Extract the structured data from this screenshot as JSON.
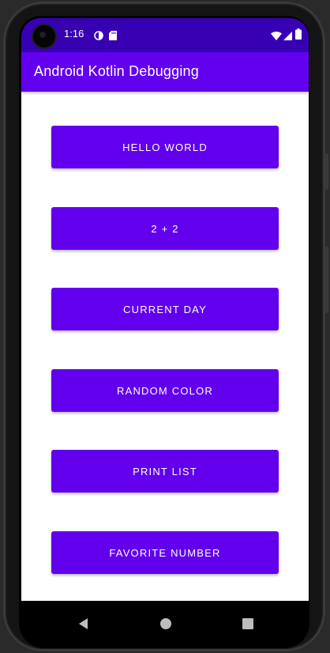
{
  "status_bar": {
    "time": "1:16",
    "icons": [
      "data-saver-icon",
      "sd-card-icon",
      "wifi-icon",
      "signal-icon",
      "battery-icon"
    ]
  },
  "app_bar": {
    "title": "Android Kotlin Debugging"
  },
  "buttons": [
    {
      "label": "HELLO WORLD"
    },
    {
      "label": "2 + 2"
    },
    {
      "label": "CURRENT DAY"
    },
    {
      "label": "RANDOM COLOR"
    },
    {
      "label": "PRINT LIST"
    },
    {
      "label": "FAVORITE NUMBER"
    }
  ],
  "nav_bar": {
    "icons": [
      "back-icon",
      "home-icon",
      "recents-icon"
    ]
  },
  "colors": {
    "primary": "#6200ee",
    "primary_dark": "#3700b3",
    "background": "#ffffff",
    "on_primary": "#ffffff"
  }
}
